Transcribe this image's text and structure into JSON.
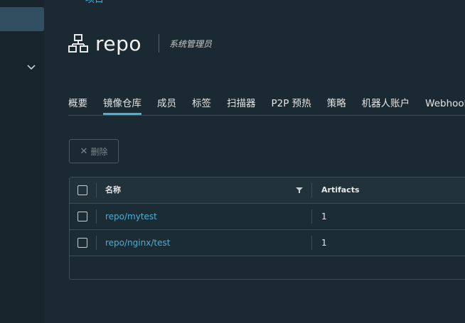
{
  "top_link": "项目",
  "project": {
    "name": "repo",
    "role": "系统管理员"
  },
  "tabs": [
    {
      "label": "概要",
      "active": false
    },
    {
      "label": "镜像仓库",
      "active": true
    },
    {
      "label": "成员",
      "active": false
    },
    {
      "label": "标签",
      "active": false
    },
    {
      "label": "扫描器",
      "active": false
    },
    {
      "label": "P2P 预热",
      "active": false
    },
    {
      "label": "策略",
      "active": false
    },
    {
      "label": "机器人账户",
      "active": false
    },
    {
      "label": "Webhooks",
      "active": false
    }
  ],
  "toolbar": {
    "delete_label": "删除"
  },
  "table": {
    "columns": [
      "名称",
      "Artifacts"
    ],
    "rows": [
      {
        "name": "repo/mytest",
        "artifacts": "1"
      },
      {
        "name": "repo/nginx/test",
        "artifacts": "1"
      }
    ]
  },
  "colors": {
    "background": "#1b2a32",
    "sidebar": "#17242b",
    "accent": "#4aaed9"
  }
}
